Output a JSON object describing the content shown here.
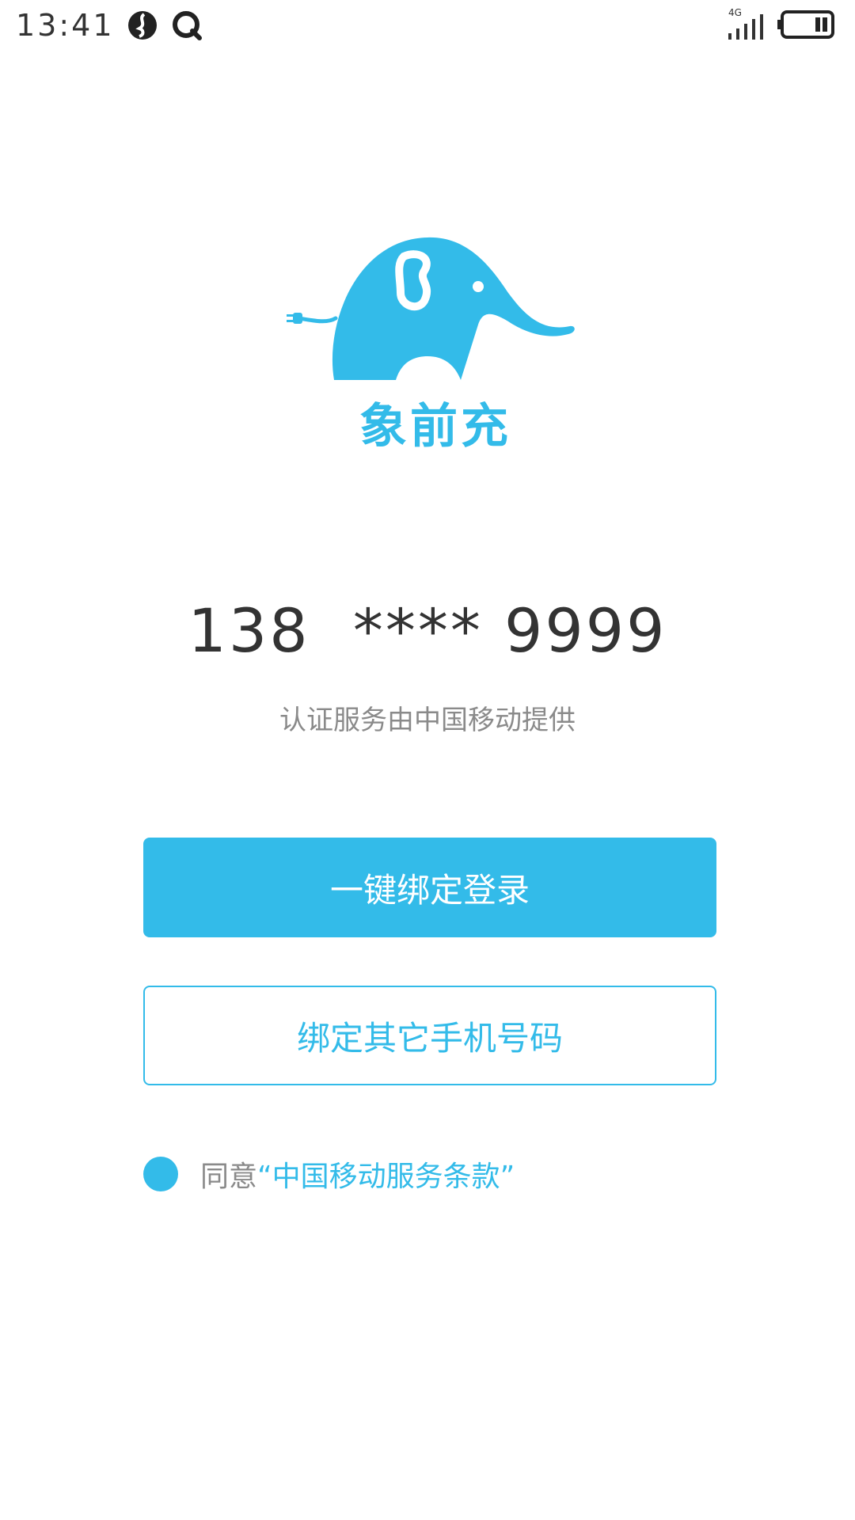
{
  "status_bar": {
    "time": "13:41",
    "network_label": "4G",
    "icons": [
      "app-notification-icon",
      "q-app-icon",
      "signal-icon",
      "battery-icon"
    ]
  },
  "logo": {
    "text": "象前充",
    "color": "#33bbe9"
  },
  "auth": {
    "phone_number": "138  **** 9999",
    "provider_note": "认证服务由中国移动提供"
  },
  "buttons": {
    "one_click_login": "一键绑定登录",
    "bind_other_number": "绑定其它手机号码"
  },
  "terms": {
    "agree_prefix": "同意",
    "link_text": "“中国移动服务条款”",
    "checked": true
  },
  "colors": {
    "accent": "#33bbe9",
    "text_dark": "#333333",
    "text_muted": "#8a8a8a"
  }
}
